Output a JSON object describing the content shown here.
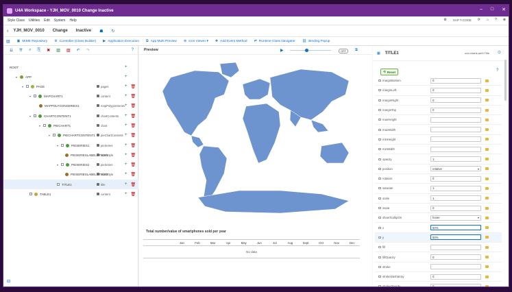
{
  "window": {
    "title": "U4A Workspace - YJH_MOV_0010 Change Inactive"
  },
  "menu": {
    "items": [
      "Style Class",
      "Utilities",
      "Edit",
      "System",
      "Help"
    ],
    "tcode": "SAP T-CODE"
  },
  "shell": {
    "object": "YJH_MOV_0010",
    "mode": "Change",
    "status": "Inactive"
  },
  "toolbar": {
    "items": [
      "MIME Repository",
      "Controller (Class Builder)",
      "Application Execution",
      "App Multi Preview",
      "Icon Viewer",
      "Add Event Method",
      "Runtime Class Navigator",
      "Binding Popup"
    ]
  },
  "tree": {
    "rows": [
      {
        "label": "ROOT",
        "tag": "",
        "level": 0
      },
      {
        "label": "APP",
        "tag": "",
        "level": 1
      },
      {
        "label": "PAGE",
        "tag": "pages",
        "level": 2
      },
      {
        "label": "MAPCHART1",
        "tag": "content",
        "level": 3
      },
      {
        "label": "MAPPOLYGONSERIES1",
        "tag": "mapPolygonSeries",
        "level": 4
      },
      {
        "label": "CHARTCONTENT1",
        "tag": "chartContents",
        "level": 3
      },
      {
        "label": "PIECHART1",
        "tag": "chart",
        "level": 4
      },
      {
        "label": "PIECHARTCONTENT1",
        "tag": "pieChartContents",
        "level": 5
      },
      {
        "label": "PIESERIES1",
        "tag": "pieSeries",
        "level": 6
      },
      {
        "label": "PIESERIESLABELSTYLE1",
        "tag": "labelStyle",
        "level": 7
      },
      {
        "label": "PIESERIES2",
        "tag": "pieSeries",
        "level": 6
      },
      {
        "label": "PIESERIESLABELSTYLE2",
        "tag": "labelStyle",
        "level": 7
      },
      {
        "label": "TITLE1",
        "tag": "title",
        "level": 5
      },
      {
        "label": "TABLE1",
        "tag": "content",
        "level": 3
      }
    ]
  },
  "preview": {
    "title": "Preview",
    "zoom": "OFF",
    "caption": "Total number/value of smartphones sold per year",
    "months": [
      "Jan",
      "Feb",
      "Mar",
      "Apr",
      "May",
      "Jun",
      "Jul",
      "Aug",
      "Sept",
      "Oct",
      "Nov",
      "Dec"
    ],
    "no_data": "No data"
  },
  "properties": {
    "title": "TITLE1",
    "subtitle": "u4a.charts.am5.Title",
    "reset": "Reset",
    "rows": [
      {
        "name": "marginBottom",
        "value": "0"
      },
      {
        "name": "marginLeft",
        "value": "0"
      },
      {
        "name": "marginRight",
        "value": "0"
      },
      {
        "name": "marginTop",
        "value": "0"
      },
      {
        "name": "maxHeight",
        "value": ""
      },
      {
        "name": "maxWidth",
        "value": ""
      },
      {
        "name": "minHeight",
        "value": ""
      },
      {
        "name": "minWidth",
        "value": ""
      },
      {
        "name": "opacity",
        "value": "1"
      },
      {
        "name": "position",
        "value": "relative"
      },
      {
        "name": "rotation",
        "value": "0"
      },
      {
        "name": "saturate",
        "value": "1"
      },
      {
        "name": "scale",
        "value": "1"
      },
      {
        "name": "sepia",
        "value": "0"
      },
      {
        "name": "showTooltipOn",
        "value": "hover"
      },
      {
        "name": "x",
        "value": "50%"
      },
      {
        "name": "y",
        "value": "50%"
      },
      {
        "name": "fill",
        "value": ""
      },
      {
        "name": "fillOpacity",
        "value": "0"
      },
      {
        "name": "stroke",
        "value": ""
      },
      {
        "name": "strokeDasharray",
        "value": "0"
      },
      {
        "name": "strokeOpacity",
        "value": "0"
      }
    ]
  }
}
